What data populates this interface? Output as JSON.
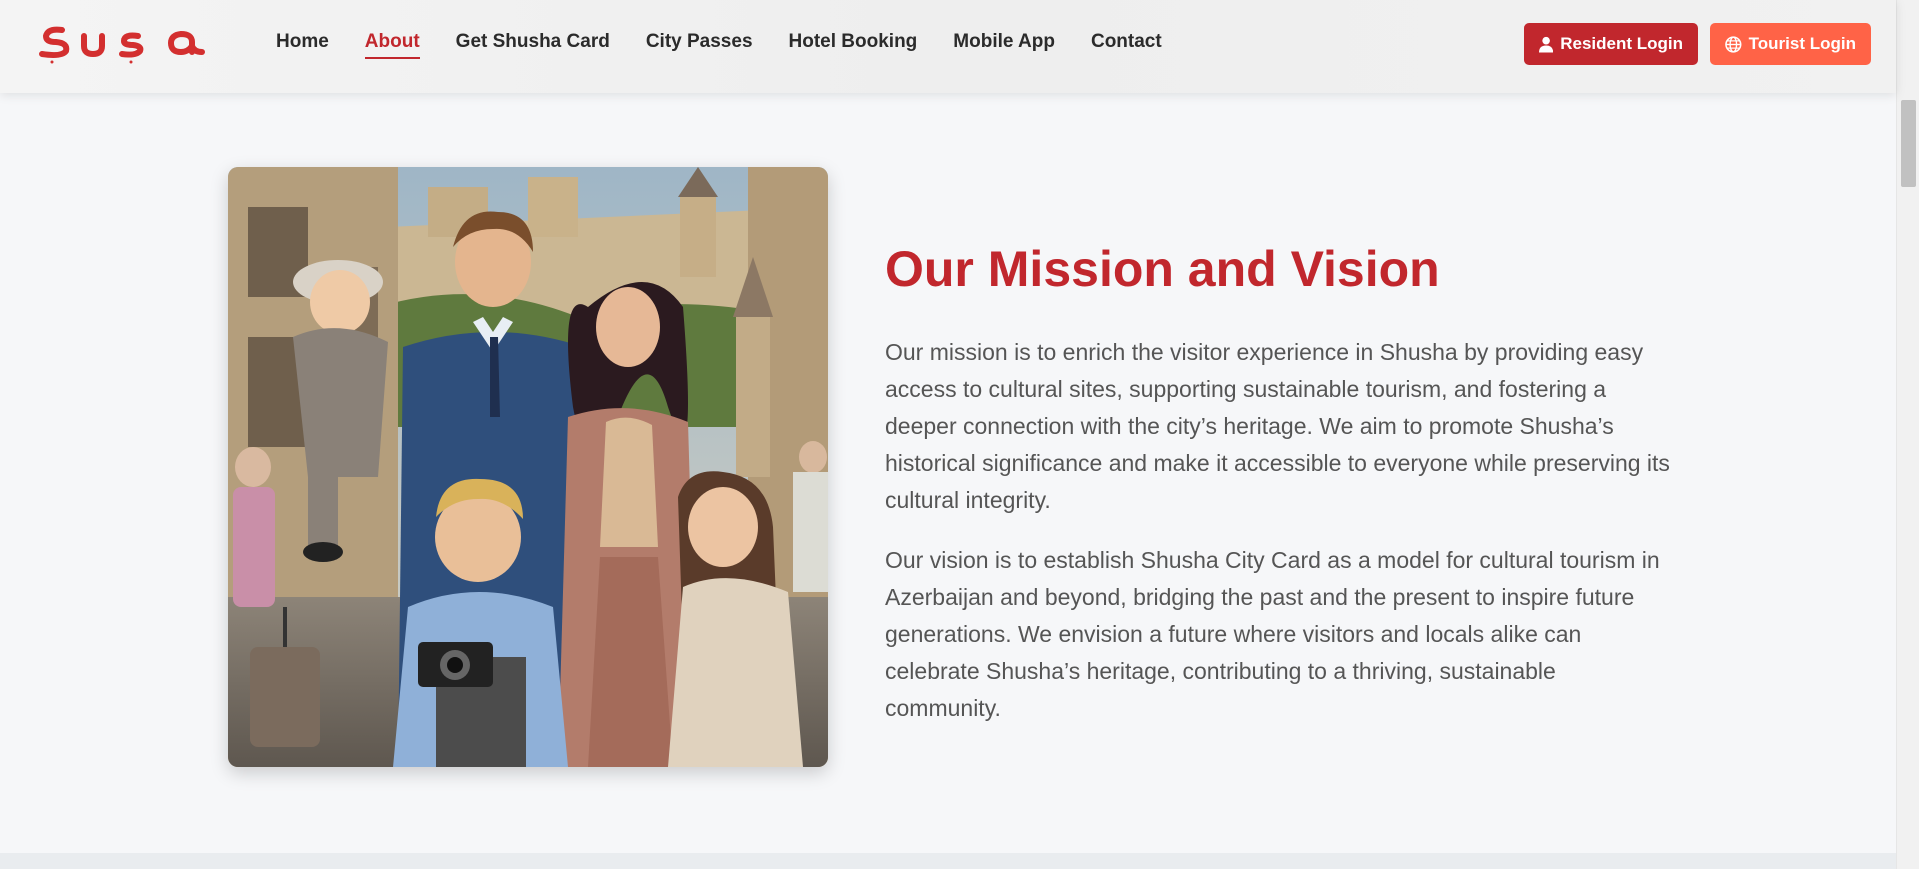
{
  "header": {
    "logo_text": "Şuşa",
    "nav": [
      {
        "label": "Home",
        "active": false
      },
      {
        "label": "About",
        "active": true
      },
      {
        "label": "Get Shusha Card",
        "active": false
      },
      {
        "label": "City Passes",
        "active": false
      },
      {
        "label": "Hotel Booking",
        "active": false
      },
      {
        "label": "Mobile App",
        "active": false
      },
      {
        "label": "Contact",
        "active": false
      }
    ],
    "resident_login": {
      "label": "Resident Login",
      "icon": "user-icon"
    },
    "tourist_login": {
      "label": "Tourist Login",
      "icon": "globe-icon"
    }
  },
  "main": {
    "image": {
      "subject": "family-tourists-photo"
    },
    "title": "Our Mission and Vision",
    "paragraphs": [
      "Our mission is to enrich the visitor experience in Shusha by providing easy access to cultural sites, supporting sustainable tourism, and fostering a deeper connection with the city’s heritage. We aim to promote Shusha’s historical significance and make it accessible to everyone while preserving its cultural integrity.",
      "Our vision is to establish Shusha City Card as a model for cultural tourism in Azerbaijan and beyond, bridging the past and the present to inspire future generations. We envision a future where visitors and locals alike can celebrate Shusha’s heritage, contributing to a thriving, sustainable community."
    ]
  },
  "colors": {
    "brand_red": "#c1272d",
    "tourist_orange": "#ff6347",
    "text_gray": "#555555",
    "nav_text": "#2b2b2b",
    "background": "#f6f7f9"
  }
}
